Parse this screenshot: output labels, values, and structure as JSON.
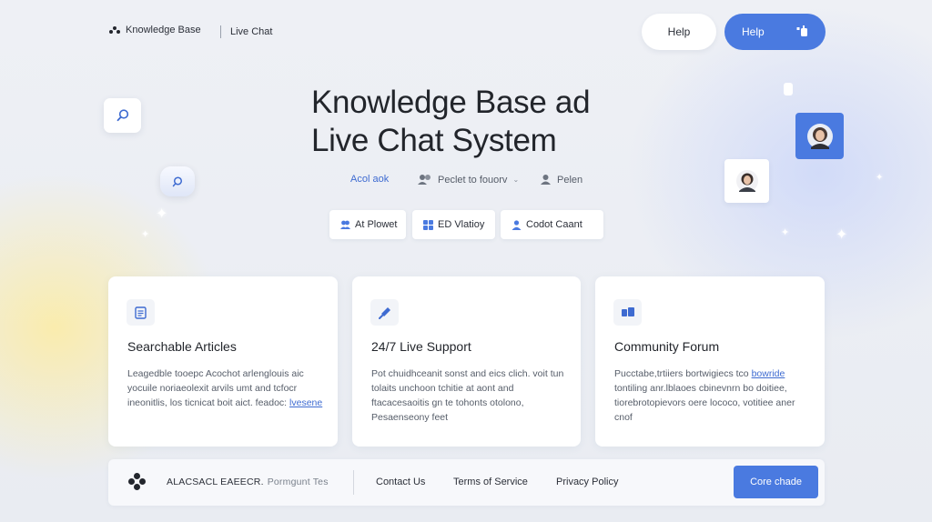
{
  "nav": {
    "brand": "Knowledge Base",
    "link": "Live Chat",
    "help_secondary": "Help",
    "help_primary": "Help"
  },
  "hero": {
    "title_line1": "Knowledge Base ad",
    "title_line2": "Live Chat System",
    "meta": [
      "Acol aok",
      "Peclet to fouorv",
      "Pelen"
    ],
    "chips": [
      "At Plowet",
      "ED Vlatioy",
      "Codot Caant"
    ]
  },
  "cards": [
    {
      "title": "Searchable Articles",
      "body": "Leagedble tooepc Acochot arlenglouis aic yocuile noriaeolexit arvils umt and tcfocr ineonitlis, los ticnicat boit aict. feadoc:",
      "link": "lvesene",
      "icon": "document-icon"
    },
    {
      "title": "24/7 Live Support",
      "body": "Pot chuidhceanit sonst and eics clich. voit tun tolaits unchoon tchitie at aont and ftacacesaoitis gn te tohonts otolono, Pesaenseony feet",
      "link": "",
      "icon": "wrench-icon"
    },
    {
      "title": "Community Forum",
      "body": "Pucctabe,trtiiers bortwigiecs tco",
      "link": "bowride",
      "body_2": "tontiling anr.lblaoes cbinevnrn bo doitiee, tiorebrotopievors oere lococo, votitiee aner cnof",
      "icon": "forum-icon"
    }
  ],
  "footer": {
    "brand": "ALACSACL EAEECR.",
    "brand_sub": "Pormgunt Tes",
    "links": [
      "Contact Us",
      "Terms of Service",
      "Privacy Policy"
    ],
    "cta": "Core chade"
  },
  "colors": {
    "accent": "#4a7ae0",
    "background": "#eef0f5",
    "text": "#22252b"
  }
}
